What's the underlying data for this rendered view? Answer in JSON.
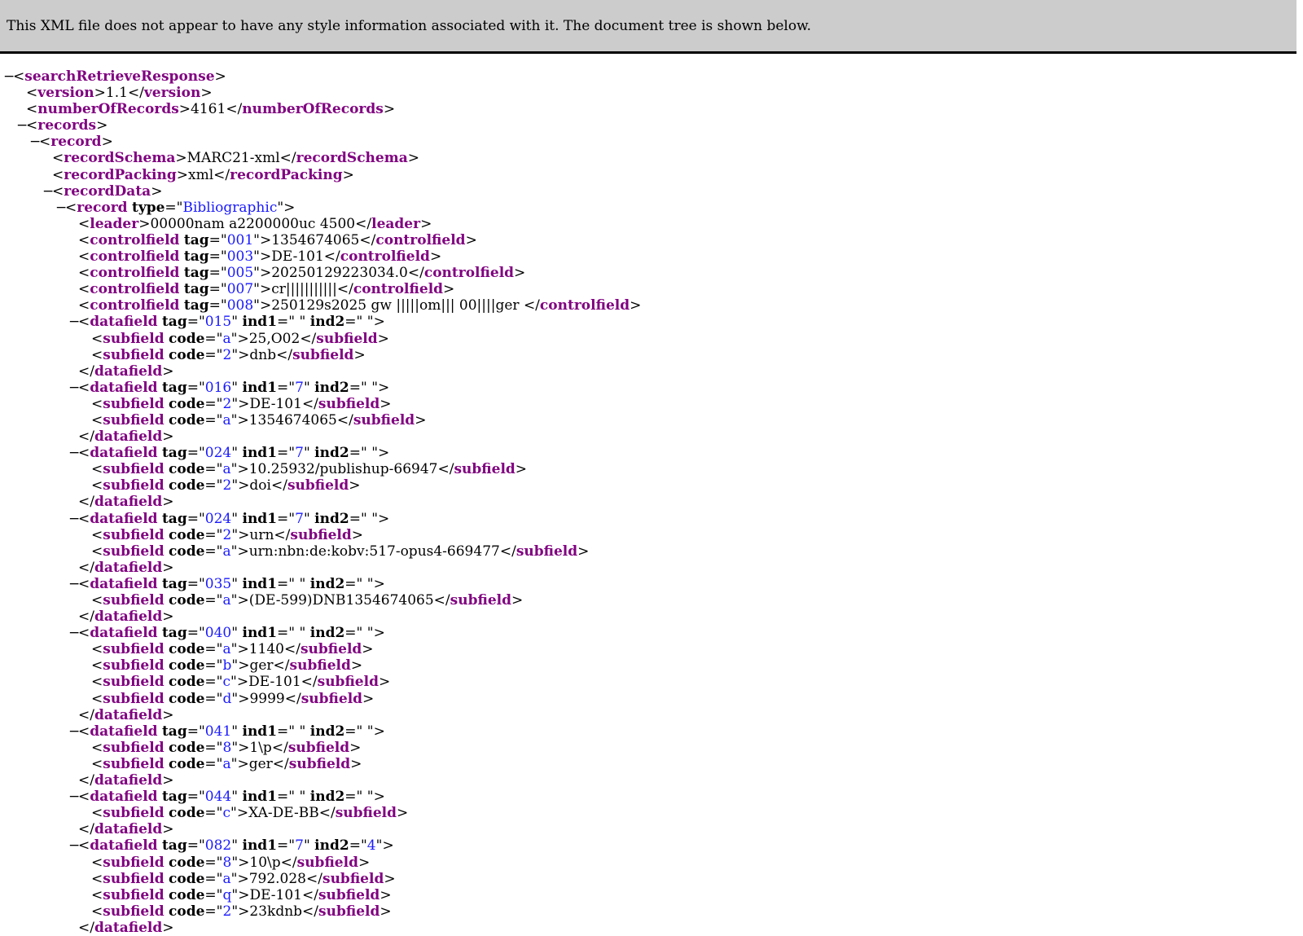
{
  "info_bar": {
    "message": "This XML file does not appear to have any style information associated with it. The document tree is shown below."
  },
  "toggle_glyph": "−",
  "tree": [
    {
      "d": 0,
      "t": "open",
      "c": 1,
      "n": "searchRetrieveResponse",
      "a": []
    },
    {
      "d": 1,
      "t": "text",
      "n": "version",
      "a": [],
      "v": "1.1"
    },
    {
      "d": 1,
      "t": "text",
      "n": "numberOfRecords",
      "a": [],
      "v": "4161"
    },
    {
      "d": 1,
      "t": "open",
      "c": 1,
      "n": "records",
      "a": []
    },
    {
      "d": 2,
      "t": "open",
      "c": 1,
      "n": "record",
      "a": []
    },
    {
      "d": 3,
      "t": "text",
      "n": "recordSchema",
      "a": [],
      "v": "MARC21-xml"
    },
    {
      "d": 3,
      "t": "text",
      "n": "recordPacking",
      "a": [],
      "v": "xml"
    },
    {
      "d": 3,
      "t": "open",
      "c": 1,
      "n": "recordData",
      "a": []
    },
    {
      "d": 4,
      "t": "open",
      "c": 1,
      "n": "record",
      "a": [
        [
          "type",
          "Bibliographic"
        ]
      ]
    },
    {
      "d": 5,
      "t": "text",
      "n": "leader",
      "a": [],
      "v": "00000nam a2200000uc 4500"
    },
    {
      "d": 5,
      "t": "text",
      "n": "controlfield",
      "a": [
        [
          "tag",
          "001"
        ]
      ],
      "v": "1354674065"
    },
    {
      "d": 5,
      "t": "text",
      "n": "controlfield",
      "a": [
        [
          "tag",
          "003"
        ]
      ],
      "v": "DE-101"
    },
    {
      "d": 5,
      "t": "text",
      "n": "controlfield",
      "a": [
        [
          "tag",
          "005"
        ]
      ],
      "v": "20250129223034.0"
    },
    {
      "d": 5,
      "t": "text",
      "n": "controlfield",
      "a": [
        [
          "tag",
          "007"
        ]
      ],
      "v": "cr|||||||||||"
    },
    {
      "d": 5,
      "t": "text",
      "n": "controlfield",
      "a": [
        [
          "tag",
          "008"
        ]
      ],
      "v": "250129s2025 gw |||||om||| 00||||ger "
    },
    {
      "d": 5,
      "t": "open",
      "c": 1,
      "n": "datafield",
      "a": [
        [
          "tag",
          "015"
        ],
        [
          "ind1",
          " "
        ],
        [
          "ind2",
          " "
        ]
      ]
    },
    {
      "d": 6,
      "t": "text",
      "n": "subfield",
      "a": [
        [
          "code",
          "a"
        ]
      ],
      "v": "25,O02"
    },
    {
      "d": 6,
      "t": "text",
      "n": "subfield",
      "a": [
        [
          "code",
          "2"
        ]
      ],
      "v": "dnb"
    },
    {
      "d": 5,
      "t": "close",
      "n": "datafield"
    },
    {
      "d": 5,
      "t": "open",
      "c": 1,
      "n": "datafield",
      "a": [
        [
          "tag",
          "016"
        ],
        [
          "ind1",
          "7"
        ],
        [
          "ind2",
          " "
        ]
      ]
    },
    {
      "d": 6,
      "t": "text",
      "n": "subfield",
      "a": [
        [
          "code",
          "2"
        ]
      ],
      "v": "DE-101"
    },
    {
      "d": 6,
      "t": "text",
      "n": "subfield",
      "a": [
        [
          "code",
          "a"
        ]
      ],
      "v": "1354674065"
    },
    {
      "d": 5,
      "t": "close",
      "n": "datafield"
    },
    {
      "d": 5,
      "t": "open",
      "c": 1,
      "n": "datafield",
      "a": [
        [
          "tag",
          "024"
        ],
        [
          "ind1",
          "7"
        ],
        [
          "ind2",
          " "
        ]
      ]
    },
    {
      "d": 6,
      "t": "text",
      "n": "subfield",
      "a": [
        [
          "code",
          "a"
        ]
      ],
      "v": "10.25932/publishup-66947"
    },
    {
      "d": 6,
      "t": "text",
      "n": "subfield",
      "a": [
        [
          "code",
          "2"
        ]
      ],
      "v": "doi"
    },
    {
      "d": 5,
      "t": "close",
      "n": "datafield"
    },
    {
      "d": 5,
      "t": "open",
      "c": 1,
      "n": "datafield",
      "a": [
        [
          "tag",
          "024"
        ],
        [
          "ind1",
          "7"
        ],
        [
          "ind2",
          " "
        ]
      ]
    },
    {
      "d": 6,
      "t": "text",
      "n": "subfield",
      "a": [
        [
          "code",
          "2"
        ]
      ],
      "v": "urn"
    },
    {
      "d": 6,
      "t": "text",
      "n": "subfield",
      "a": [
        [
          "code",
          "a"
        ]
      ],
      "v": "urn:nbn:de:kobv:517-opus4-669477"
    },
    {
      "d": 5,
      "t": "close",
      "n": "datafield"
    },
    {
      "d": 5,
      "t": "open",
      "c": 1,
      "n": "datafield",
      "a": [
        [
          "tag",
          "035"
        ],
        [
          "ind1",
          " "
        ],
        [
          "ind2",
          " "
        ]
      ]
    },
    {
      "d": 6,
      "t": "text",
      "n": "subfield",
      "a": [
        [
          "code",
          "a"
        ]
      ],
      "v": "(DE-599)DNB1354674065"
    },
    {
      "d": 5,
      "t": "close",
      "n": "datafield"
    },
    {
      "d": 5,
      "t": "open",
      "c": 1,
      "n": "datafield",
      "a": [
        [
          "tag",
          "040"
        ],
        [
          "ind1",
          " "
        ],
        [
          "ind2",
          " "
        ]
      ]
    },
    {
      "d": 6,
      "t": "text",
      "n": "subfield",
      "a": [
        [
          "code",
          "a"
        ]
      ],
      "v": "1140"
    },
    {
      "d": 6,
      "t": "text",
      "n": "subfield",
      "a": [
        [
          "code",
          "b"
        ]
      ],
      "v": "ger"
    },
    {
      "d": 6,
      "t": "text",
      "n": "subfield",
      "a": [
        [
          "code",
          "c"
        ]
      ],
      "v": "DE-101"
    },
    {
      "d": 6,
      "t": "text",
      "n": "subfield",
      "a": [
        [
          "code",
          "d"
        ]
      ],
      "v": "9999"
    },
    {
      "d": 5,
      "t": "close",
      "n": "datafield"
    },
    {
      "d": 5,
      "t": "open",
      "c": 1,
      "n": "datafield",
      "a": [
        [
          "tag",
          "041"
        ],
        [
          "ind1",
          " "
        ],
        [
          "ind2",
          " "
        ]
      ]
    },
    {
      "d": 6,
      "t": "text",
      "n": "subfield",
      "a": [
        [
          "code",
          "8"
        ]
      ],
      "v": "1\\p"
    },
    {
      "d": 6,
      "t": "text",
      "n": "subfield",
      "a": [
        [
          "code",
          "a"
        ]
      ],
      "v": "ger"
    },
    {
      "d": 5,
      "t": "close",
      "n": "datafield"
    },
    {
      "d": 5,
      "t": "open",
      "c": 1,
      "n": "datafield",
      "a": [
        [
          "tag",
          "044"
        ],
        [
          "ind1",
          " "
        ],
        [
          "ind2",
          " "
        ]
      ]
    },
    {
      "d": 6,
      "t": "text",
      "n": "subfield",
      "a": [
        [
          "code",
          "c"
        ]
      ],
      "v": "XA-DE-BB"
    },
    {
      "d": 5,
      "t": "close",
      "n": "datafield"
    },
    {
      "d": 5,
      "t": "open",
      "c": 1,
      "n": "datafield",
      "a": [
        [
          "tag",
          "082"
        ],
        [
          "ind1",
          "7"
        ],
        [
          "ind2",
          "4"
        ]
      ]
    },
    {
      "d": 6,
      "t": "text",
      "n": "subfield",
      "a": [
        [
          "code",
          "8"
        ]
      ],
      "v": "10\\p"
    },
    {
      "d": 6,
      "t": "text",
      "n": "subfield",
      "a": [
        [
          "code",
          "a"
        ]
      ],
      "v": "792.028"
    },
    {
      "d": 6,
      "t": "text",
      "n": "subfield",
      "a": [
        [
          "code",
          "q"
        ]
      ],
      "v": "DE-101"
    },
    {
      "d": 6,
      "t": "text",
      "n": "subfield",
      "a": [
        [
          "code",
          "2"
        ]
      ],
      "v": "23kdnb"
    },
    {
      "d": 5,
      "t": "close",
      "n": "datafield"
    }
  ]
}
